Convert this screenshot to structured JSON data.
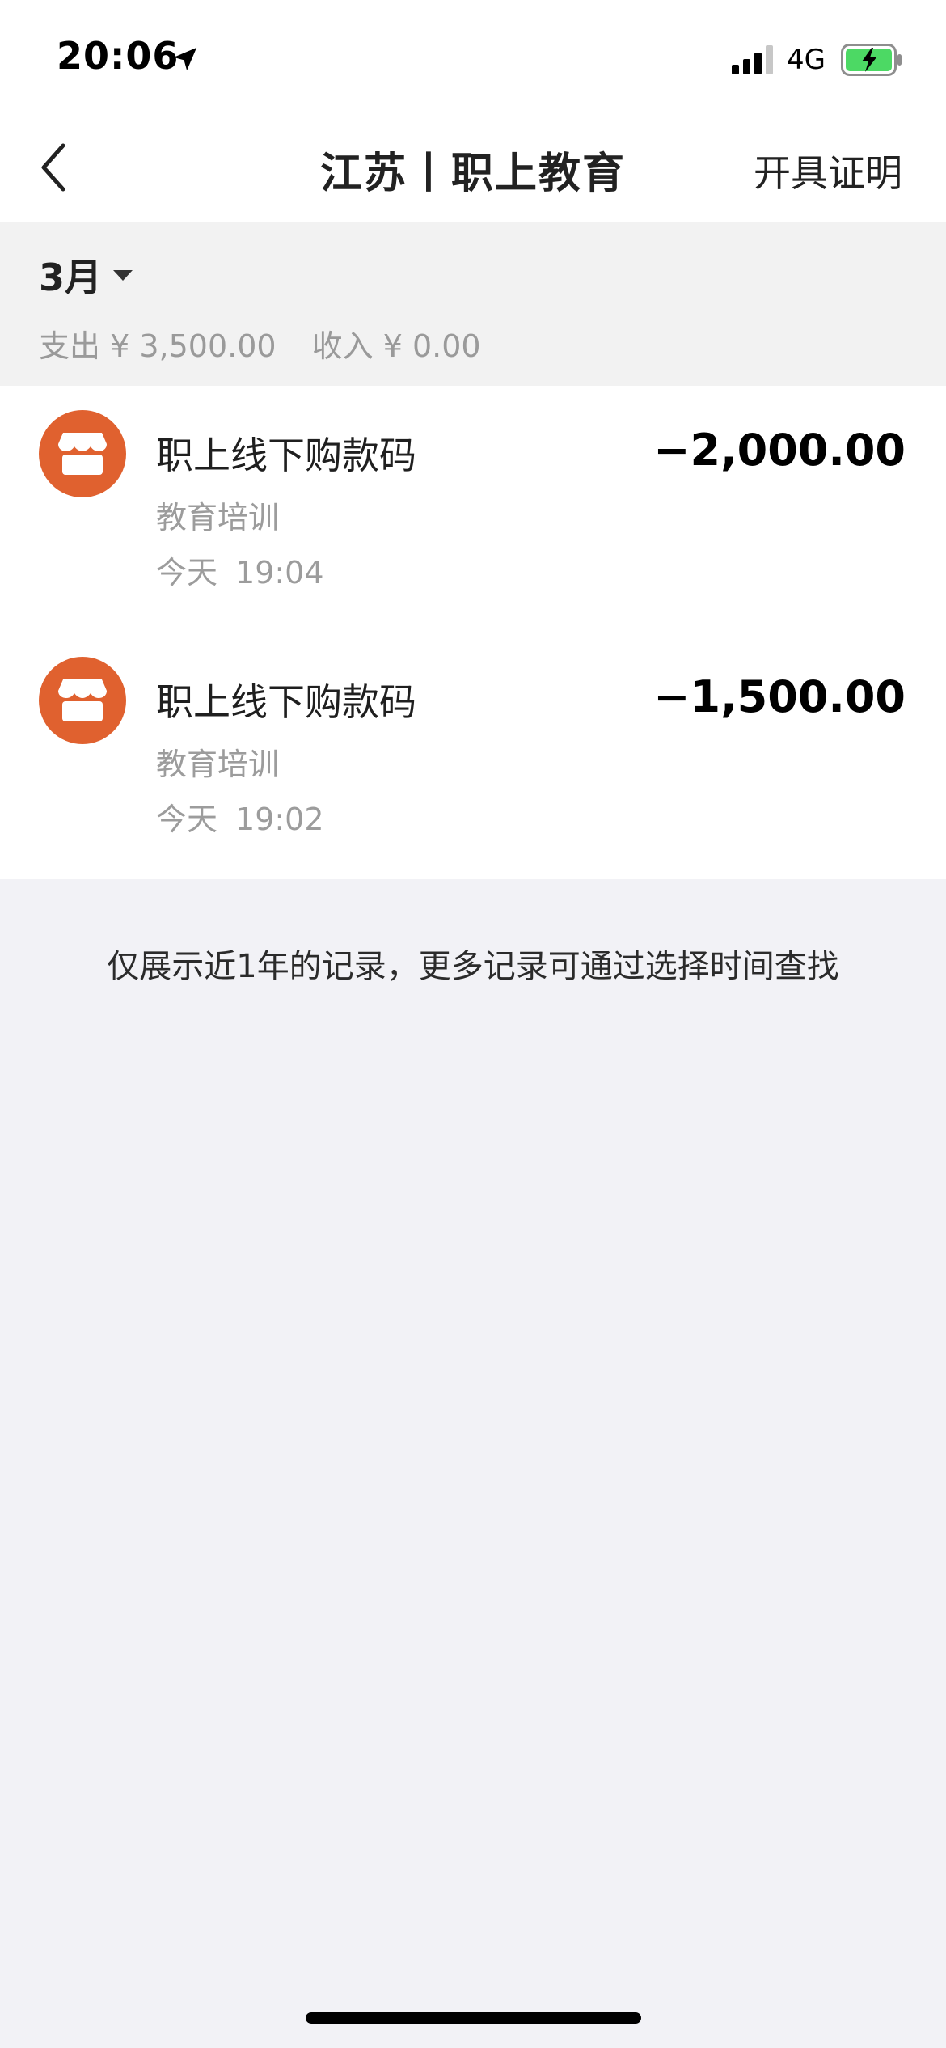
{
  "status_bar": {
    "time": "20:06",
    "network": "4G",
    "icons": [
      "location-arrow-icon",
      "signal-icon",
      "battery-charging-icon"
    ]
  },
  "nav": {
    "back_icon": "chevron-left-icon",
    "title": "江苏丨职上教育",
    "action": "开具证明"
  },
  "summary": {
    "month": "3月",
    "expense_label": "支出",
    "expense_value": "¥ 3,500.00",
    "income_label": "收入",
    "income_value": "¥ 0.00"
  },
  "transactions": [
    {
      "icon": "store-icon",
      "title": "职上线下购款码",
      "category": "教育培训",
      "day": "今天",
      "time": "19:04",
      "amount": "−2,000.00"
    },
    {
      "icon": "store-icon",
      "title": "职上线下购款码",
      "category": "教育培训",
      "day": "今天",
      "time": "19:02",
      "amount": "−1,500.00"
    }
  ],
  "footer_note": "仅展示近1年的记录，更多记录可通过选择时间查找",
  "colors": {
    "accent": "#e0612f",
    "background": "#f2f2f6",
    "secondary_text": "#9c9c9c"
  }
}
